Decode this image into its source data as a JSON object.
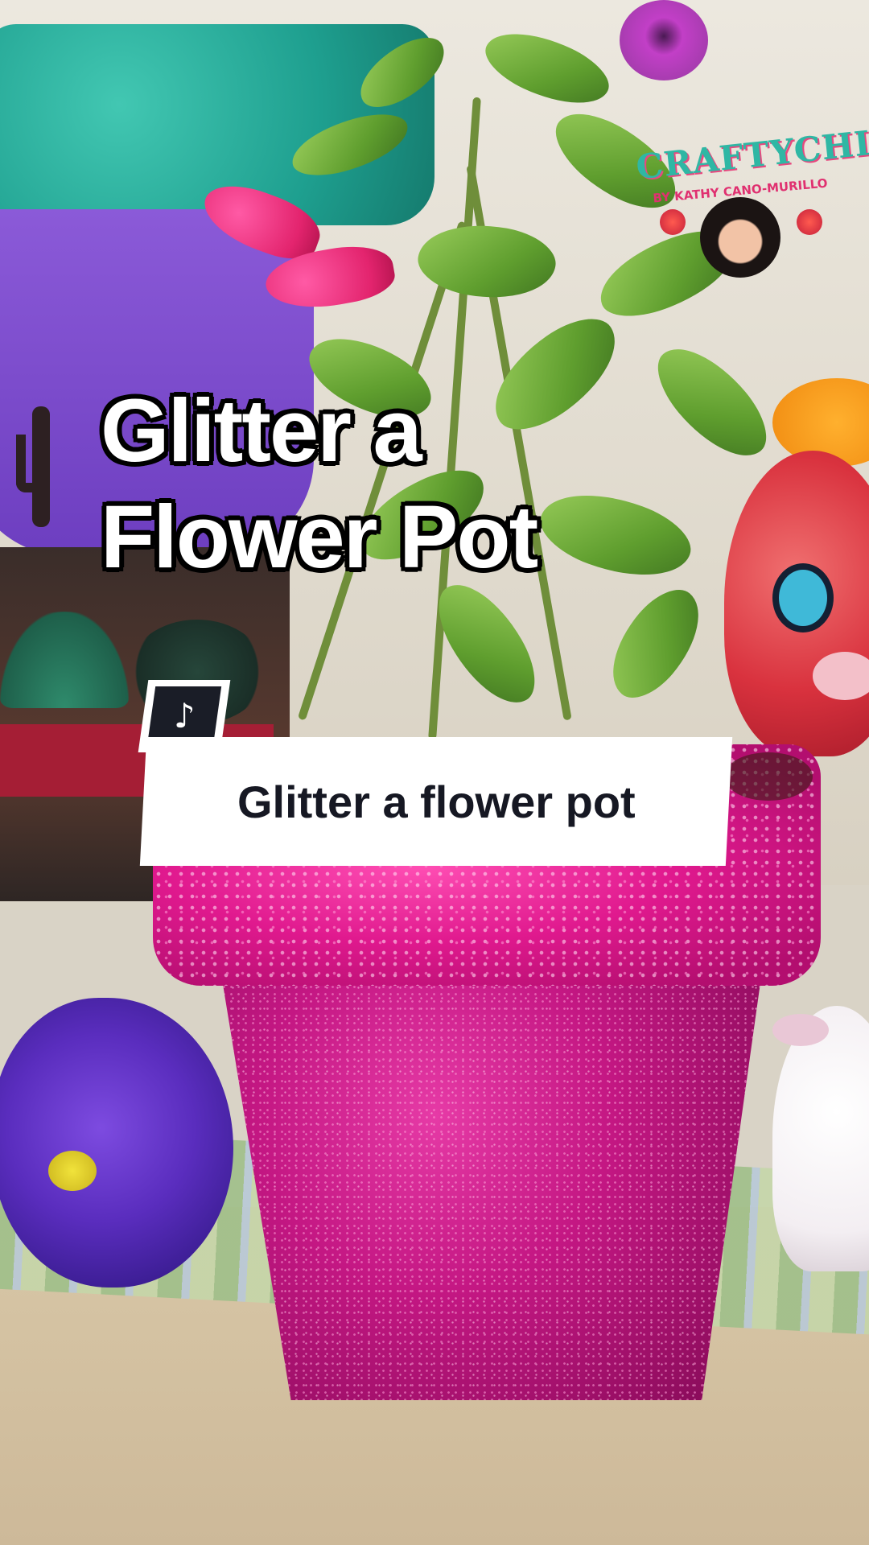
{
  "headline": {
    "line1": "Glitter a",
    "line2": "Flower Pot"
  },
  "caption": {
    "text": "Glitter a flower pot",
    "platform_icon": "tiktok-note-icon"
  },
  "logo": {
    "title": "CRAFTYCHICA",
    "subtitle": "BY KATHY CANO-MURILLO"
  },
  "colors": {
    "glitter_pink": "#d61b8e",
    "caption_bg": "#ffffff",
    "caption_text": "#161823",
    "badge_bg": "#1a1d27"
  }
}
